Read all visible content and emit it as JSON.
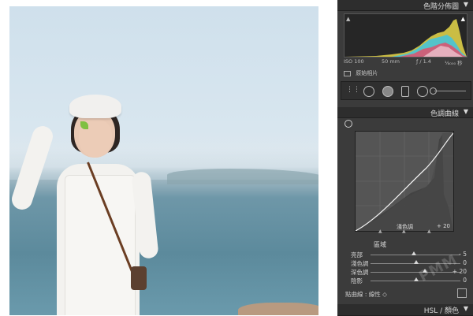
{
  "panel": {
    "histogram_title": "色階分佈圖",
    "histogram": {
      "clip_left": "▲",
      "clip_right": "▲"
    },
    "exif": {
      "iso": "ISO 100",
      "focal": "50 mm",
      "aperture": "ƒ / 1.4",
      "shutter": "¹⁄₈₀₀₀ 秒"
    },
    "original_photo_label": "原始相片",
    "tone_curve_title": "色調曲線",
    "curve_region_label": "淺色調",
    "curve_region_value": "+ 20",
    "regions_title": "區域",
    "regions": [
      {
        "label": "亮部",
        "value": "- 5",
        "level": -5
      },
      {
        "label": "淺色調",
        "value": "0",
        "level": 0
      },
      {
        "label": "深色調",
        "value": "+ 20",
        "level": 20
      },
      {
        "label": "陰影",
        "value": "0",
        "level": 0
      }
    ],
    "point_curve_label": "點曲線 : 線性 ◇",
    "hsl_title": "HSL / 顏色"
  },
  "watermark": "PMM",
  "colors": {
    "panel_bg": "#3b3b3b",
    "header_bg": "#2d2d2d",
    "curve_bg": "#555555"
  }
}
